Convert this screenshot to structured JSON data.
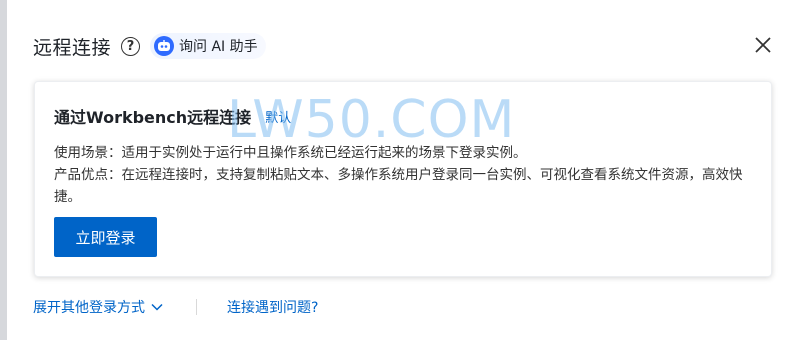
{
  "dialog": {
    "title": "远程连接",
    "help_icon": "question-circle-icon",
    "ai_assistant_label": "询问 AI 助手",
    "close_icon": "close-icon"
  },
  "card": {
    "title": "通过Workbench远程连接",
    "default_tag": "默认",
    "use_case": "使用场景：适用于实例处于运行中且操作系统已经运行起来的场景下登录实例。",
    "advantages": "产品优点：在远程连接时，支持复制粘贴文本、多操作系统用户登录同一台实例、可视化查看系统文件资源，高效快捷。",
    "login_button": "立即登录"
  },
  "watermark": "LW50.COM",
  "footer": {
    "expand_label": "展开其他登录方式",
    "problem_link": "连接遇到问题?"
  },
  "colors": {
    "primary": "#0064c8",
    "text": "#1f2329",
    "ai_icon": "#2f6bff"
  }
}
